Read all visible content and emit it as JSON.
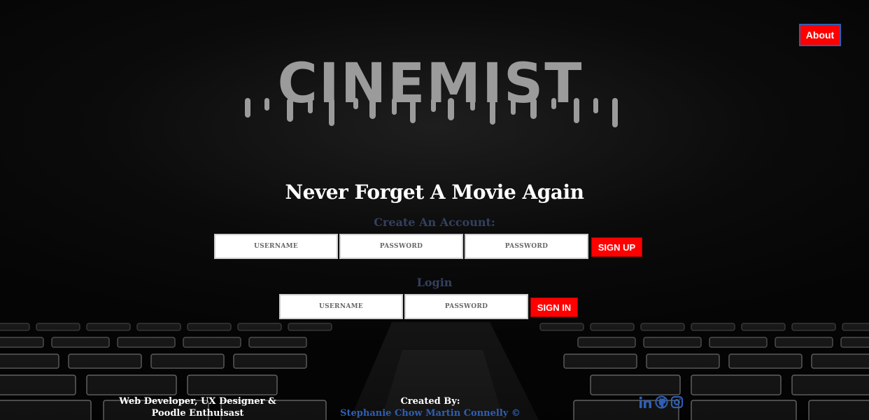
{
  "nav": {
    "about_label": "About"
  },
  "logo": {
    "text": "CINEMIST"
  },
  "headline": "Never Forget A Movie Again",
  "signup": {
    "title": "Create An Account:",
    "username_placeholder": "USERNAME",
    "password_placeholder": "PASSWORD",
    "confirm_placeholder": "PASSWORD",
    "button_label": "SIGN UP"
  },
  "login": {
    "title": "Login",
    "username_placeholder": "USERNAME",
    "password_placeholder": "PASSWORD",
    "button_label": "SIGN IN"
  },
  "footer": {
    "tagline_line1": "Web Developer, UX Designer &",
    "tagline_line2": "Poodle Enthuisast",
    "created_by": "Created By:",
    "author": "Stephanie Chow Martin Connelly ©",
    "social_icons": [
      "linkedin-icon",
      "github-icon",
      "instagram-icon"
    ]
  },
  "colors": {
    "accent_red": "#ff0000",
    "link_blue": "#2f5fb3",
    "section_title": "#33405e",
    "logo_gray": "#9b9b9b"
  }
}
